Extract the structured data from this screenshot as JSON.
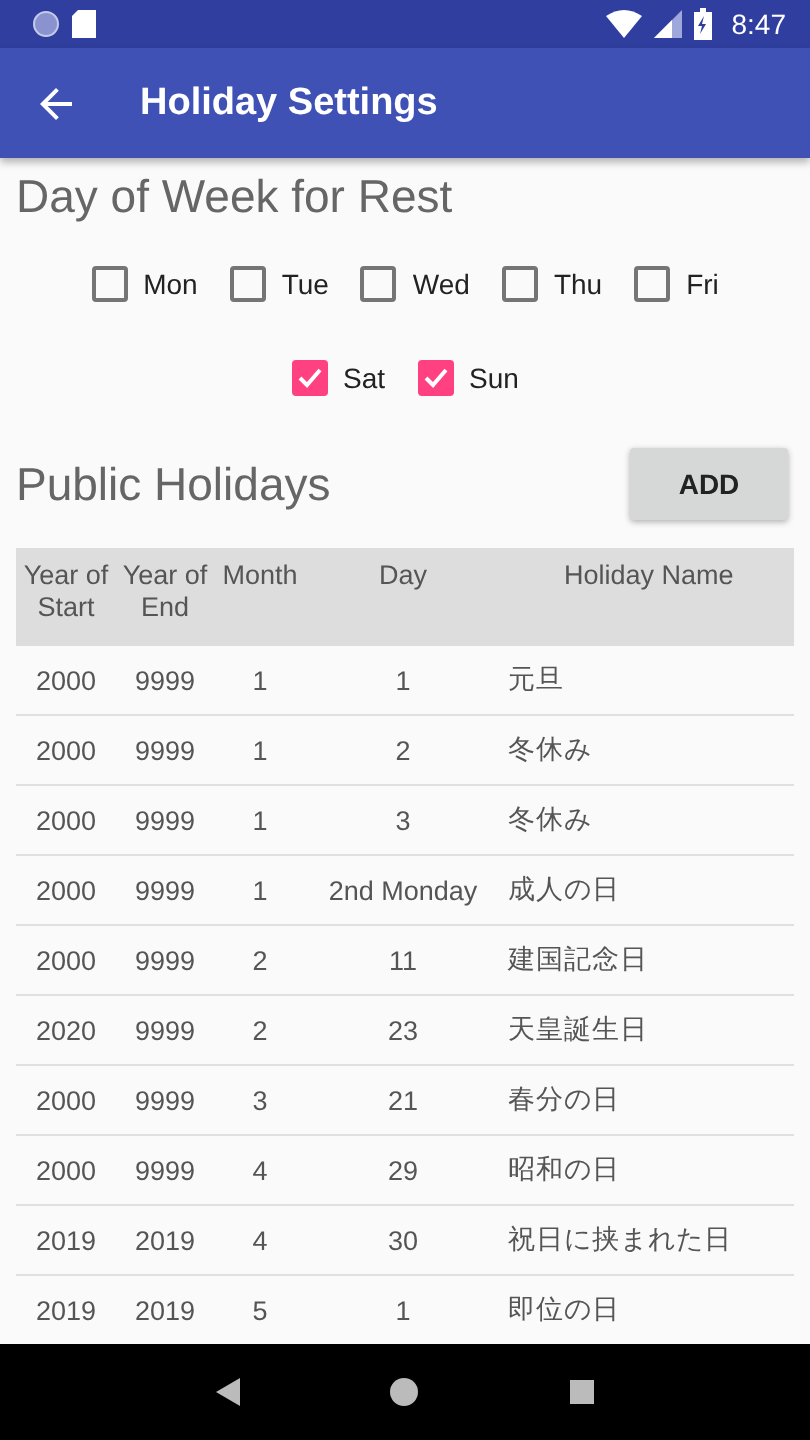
{
  "status_bar": {
    "time": "8:47"
  },
  "app_bar": {
    "title": "Holiday Settings"
  },
  "rest_days": {
    "title": "Day of Week for Rest",
    "rows": [
      [
        {
          "label": "Mon",
          "checked": false
        },
        {
          "label": "Tue",
          "checked": false
        },
        {
          "label": "Wed",
          "checked": false
        },
        {
          "label": "Thu",
          "checked": false
        },
        {
          "label": "Fri",
          "checked": false
        }
      ],
      [
        {
          "label": "Sat",
          "checked": true
        },
        {
          "label": "Sun",
          "checked": true
        }
      ]
    ]
  },
  "public_holidays": {
    "title": "Public Holidays",
    "add_button": "ADD",
    "table": {
      "columns": [
        "Year of Start",
        "Year of End",
        "Month",
        "Day",
        "Holiday Name"
      ],
      "rows": [
        [
          "2000",
          "9999",
          "1",
          "1",
          "元旦"
        ],
        [
          "2000",
          "9999",
          "1",
          "2",
          "冬休み"
        ],
        [
          "2000",
          "9999",
          "1",
          "3",
          "冬休み"
        ],
        [
          "2000",
          "9999",
          "1",
          "2nd Monday",
          "成人の日"
        ],
        [
          "2000",
          "9999",
          "2",
          "11",
          "建国記念日"
        ],
        [
          "2020",
          "9999",
          "2",
          "23",
          "天皇誕生日"
        ],
        [
          "2000",
          "9999",
          "3",
          "21",
          "春分の日"
        ],
        [
          "2000",
          "9999",
          "4",
          "29",
          "昭和の日"
        ],
        [
          "2019",
          "2019",
          "4",
          "30",
          "祝日に挟まれた日"
        ],
        [
          "2019",
          "2019",
          "5",
          "1",
          "即位の日"
        ]
      ]
    }
  }
}
